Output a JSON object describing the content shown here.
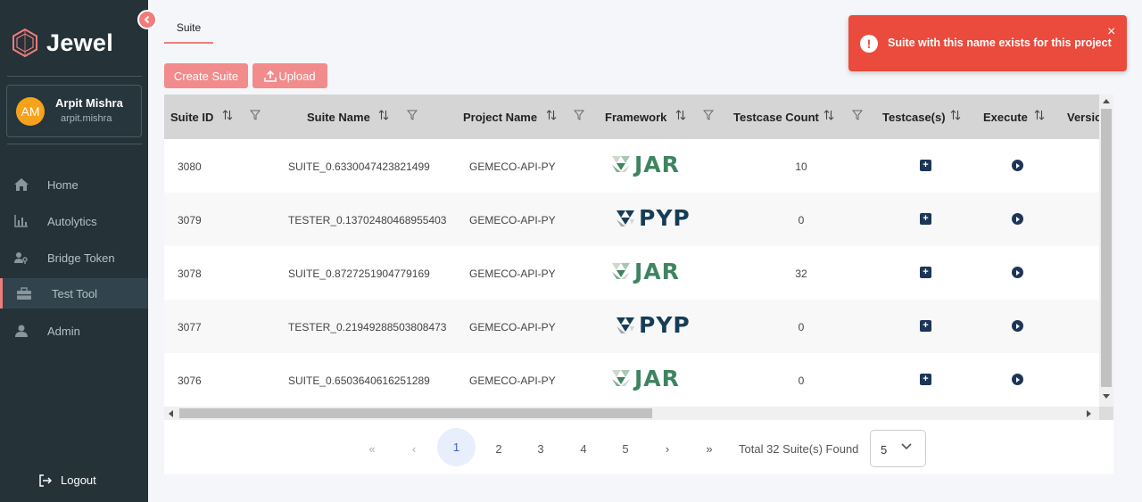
{
  "app": {
    "name": "Jewel"
  },
  "user": {
    "initials": "AM",
    "name": "Arpit Mishra",
    "username": "arpit.mishra"
  },
  "sidebar": {
    "items": [
      {
        "label": "Home",
        "icon": "home-icon"
      },
      {
        "label": "Autolytics",
        "icon": "bar-chart-icon"
      },
      {
        "label": "Bridge Token",
        "icon": "users-key-icon"
      },
      {
        "label": "Test Tool",
        "icon": "toolbox-icon",
        "active": true
      },
      {
        "label": "Admin",
        "icon": "user-icon"
      }
    ],
    "logout_label": "Logout"
  },
  "tabs": [
    {
      "label": "Suite"
    }
  ],
  "toolbar": {
    "create_label": "Create Suite",
    "upload_label": "Upload"
  },
  "table": {
    "columns": [
      "Suite ID",
      "Suite Name",
      "Project Name",
      "Framework",
      "Testcase Count",
      "Testcase(s)",
      "Execute",
      "Versio"
    ],
    "rows": [
      {
        "id": "3080",
        "name": "SUITE_0.6330047423821499",
        "project": "GEMECO-API-PY",
        "framework": "JAR",
        "count": "10"
      },
      {
        "id": "3079",
        "name": "TESTER_0.13702480468955403",
        "project": "GEMECO-API-PY",
        "framework": "PYP",
        "count": "0"
      },
      {
        "id": "3078",
        "name": "SUITE_0.8727251904779169",
        "project": "GEMECO-API-PY",
        "framework": "JAR",
        "count": "32"
      },
      {
        "id": "3077",
        "name": "TESTER_0.21949288503808473",
        "project": "GEMECO-API-PY",
        "framework": "PYP",
        "count": "0"
      },
      {
        "id": "3076",
        "name": "SUITE_0.6503640616251289",
        "project": "GEMECO-API-PY",
        "framework": "JAR",
        "count": "0"
      }
    ]
  },
  "pagination": {
    "first": "«",
    "prev": "‹",
    "pages": [
      "1",
      "2",
      "3",
      "4",
      "5"
    ],
    "current": "1",
    "next": "›",
    "last": "»",
    "total_text": "Total 32 Suite(s) Found",
    "per_page": "5"
  },
  "toast": {
    "message": "Suite with this name exists for this project",
    "icon": "error-icon",
    "close": "×"
  },
  "colors": {
    "accent": "#f07c7c",
    "sidebar": "#253238",
    "toast": "#ea4b3c",
    "jar": "#3f8461",
    "pyp": "#163d57"
  }
}
